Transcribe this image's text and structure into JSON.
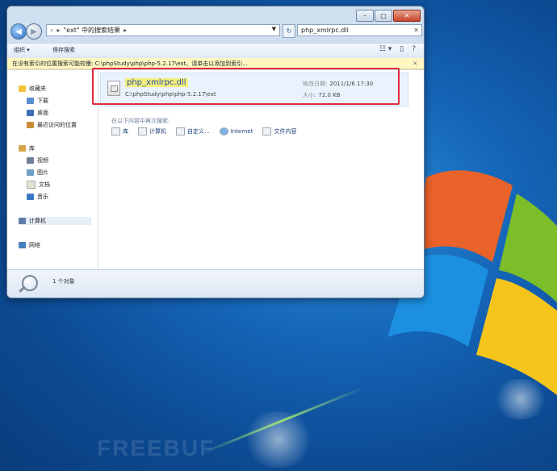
{
  "window": {
    "search_title": "\"ext\" 中的搜索结果",
    "search_query": "php_xmlrpc.dll"
  },
  "toolbar": {
    "organize": "组织",
    "save_search": "保存搜索"
  },
  "infobar": {
    "text": "在没有索引的位置搜索可能较慢: C:\\phpStudy\\php\\php-5.2.17\\ext。请单击以添加到索引..."
  },
  "sidebar": {
    "favorites": "收藏夹",
    "downloads": "下载",
    "desktop": "桌面",
    "recent": "最近访问的位置",
    "libraries": "库",
    "videos": "视频",
    "pictures": "图片",
    "documents": "文档",
    "music": "音乐",
    "computer": "计算机",
    "network": "网络"
  },
  "result": {
    "name": "php_xmlrpc.dll",
    "path": "C:\\phpStudy\\php\\php-5.2.17\\ext",
    "modified_label": "修改日期:",
    "modified_value": "2011/1/6 17:30",
    "size_label": "大小:",
    "size_value": "72.0 KB"
  },
  "search_again": {
    "label": "在以下内容中再次搜索:",
    "links": [
      "库",
      "计算机",
      "自定义...",
      "Internet",
      "文件内容"
    ]
  },
  "details": {
    "count": "1 个对象"
  },
  "watermark": "FREEBUF",
  "colors": {
    "highlight_border": "#e02a3a",
    "filename_highlight": "#f6ef7c",
    "desktop_blue": "#1565b8"
  }
}
